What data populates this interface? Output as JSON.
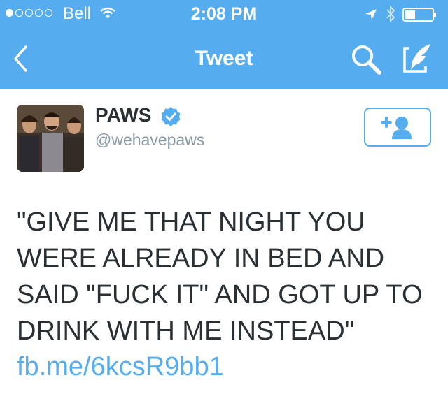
{
  "status_bar": {
    "carrier": "Bell",
    "time": "2:08 PM",
    "signal_strength": 1,
    "signal_max": 5,
    "wifi_icon": "wifi-icon",
    "location_icon": "location-arrow-icon",
    "bluetooth_icon": "bluetooth-icon",
    "battery_icon": "battery-icon"
  },
  "nav": {
    "title": "Tweet",
    "back_icon": "chevron-left-icon",
    "search_icon": "search-icon",
    "compose_icon": "compose-icon"
  },
  "tweet": {
    "author_name": "PAWS",
    "author_handle": "@wehavepaws",
    "verified_icon": "verified-badge-icon",
    "follow_icon": "add-user-icon",
    "text": "\"GIVE ME THAT NIGHT YOU WERE ALREADY IN BED AND SAID \"FUCK IT\" AND GOT UP TO DRINK WITH ME INSTEAD\"",
    "link": "fb.me/6kcsR9bb1"
  },
  "colors": {
    "header_bg": "#55acee",
    "link": "#55acee",
    "text": "#292f33",
    "handle": "#8899a6",
    "verified": "#55acee"
  }
}
